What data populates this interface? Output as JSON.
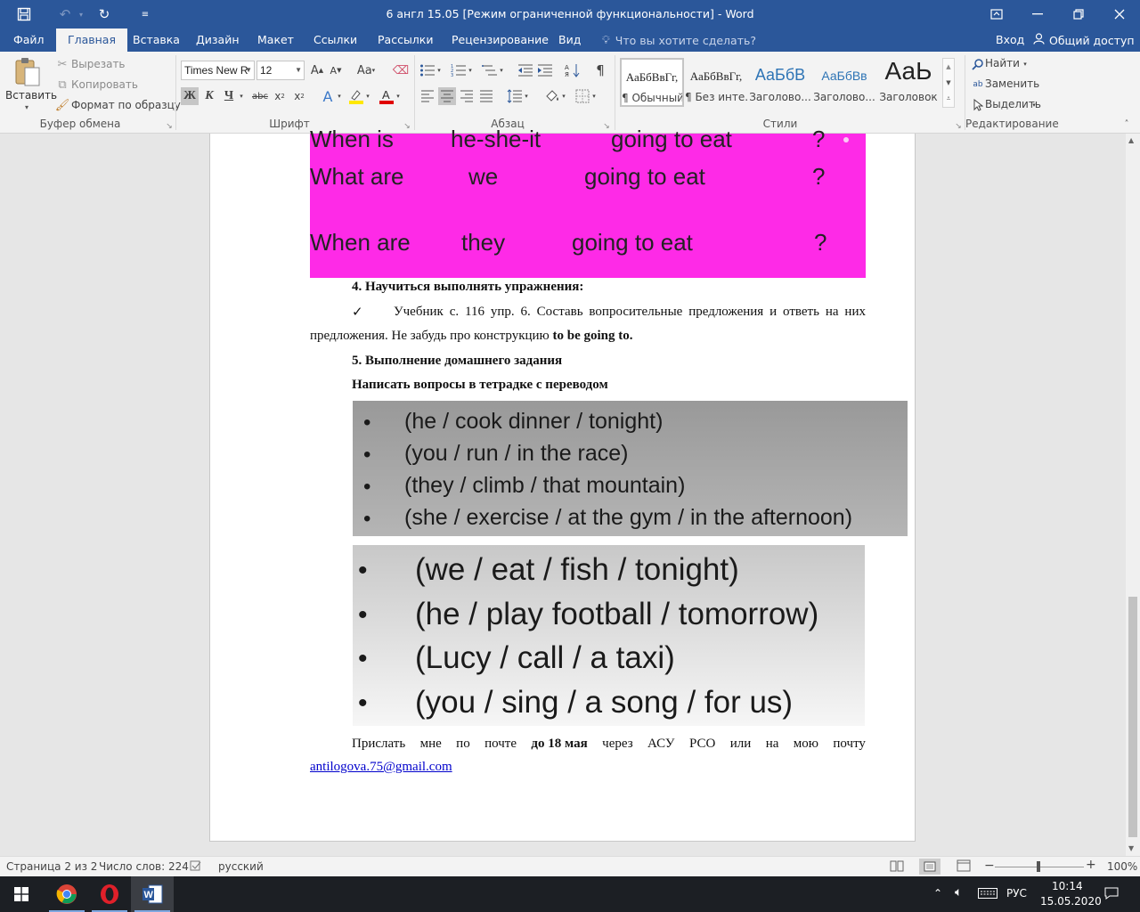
{
  "window": {
    "title": "6 англ 15.05 [Режим ограниченной функциональности] - Word"
  },
  "tabs": [
    "Файл",
    "Главная",
    "Вставка",
    "Дизайн",
    "Макет",
    "Ссылки",
    "Рассылки",
    "Рецензирование",
    "Вид"
  ],
  "active_tab": "Главная",
  "tell_me": "Что вы хотите сделать?",
  "signin": "Вход",
  "share": "Общий доступ",
  "clipboard": {
    "paste": "Вставить",
    "cut": "Вырезать",
    "copy": "Копировать",
    "format_painter": "Формат по образцу",
    "group": "Буфер обмена"
  },
  "font": {
    "name": "Times New R",
    "size": "12",
    "group": "Шрифт",
    "bold": "Ж",
    "italic": "К",
    "underline": "Ч"
  },
  "paragraph": {
    "group": "Абзац"
  },
  "styles": {
    "group": "Стили",
    "items": [
      {
        "preview": "АаБбВвГг,",
        "name": "¶ Обычный"
      },
      {
        "preview": "АаБбВвГг,",
        "name": "¶ Без инте..."
      },
      {
        "preview": "АаБбВ",
        "name": "Заголово..."
      },
      {
        "preview": "АаБбВв",
        "name": "Заголово..."
      },
      {
        "preview": "АаЬ",
        "name": "Заголовок"
      }
    ]
  },
  "editing": {
    "find": "Найти",
    "replace": "Заменить",
    "select": "Выделить",
    "group": "Редактирование"
  },
  "doc": {
    "magenta_lines": [
      [
        "When is",
        "he-she-it",
        "going to eat",
        "?"
      ],
      [
        "What are",
        "we",
        "going to eat",
        "?"
      ],
      [
        "When are",
        "they",
        "going to eat",
        "?"
      ]
    ],
    "h4": "4. Научиться выполнять упражнения:",
    "check": "✓",
    "task_line1": "Учебник с. 116 упр. 6. Составь вопросительные предложения и ответь на них",
    "task_line2_pre": "предложения. Не забудь про конструкцию",
    "task_line2_bold": "to be going to.",
    "h5": "5. Выполнение домашнего задания",
    "h5_sub": "Написать вопросы в тетрадке с переводом",
    "list1": [
      "(he / cook dinner / tonight)",
      "(you / run / in the race)",
      "(they / climb / that mountain)",
      "(she / exercise / at the gym / in the afternoon)"
    ],
    "list2": [
      "(we / eat / fish / tonight)",
      "(he / play football / tomorrow)",
      "(Lucy / call / a taxi)",
      "(you / sing / a song / for us)"
    ],
    "send_words": [
      "Прислать",
      "мне",
      "по",
      "почте",
      "до 18 мая",
      "через",
      "АСУ",
      "РСО",
      "или",
      "на",
      "мою",
      "почту"
    ],
    "email": "antilogova.75@gmail.com"
  },
  "status": {
    "page": "Страница 2 из 2",
    "words": "Число слов: 224",
    "lang": "русский",
    "zoom": "100%"
  },
  "taskbar": {
    "lang": "РУС",
    "time": "10:14",
    "date": "15.05.2020"
  },
  "colors": {
    "word_blue": "#2b579a",
    "magenta": "#fe2ae7"
  }
}
